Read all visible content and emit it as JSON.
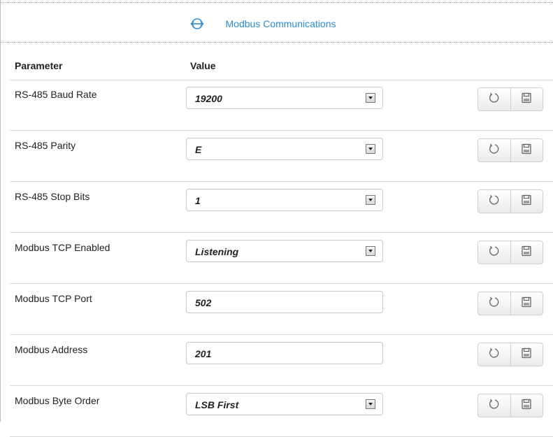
{
  "header": {
    "title": "Modbus Communications",
    "icon": "link-arrows-icon",
    "accent_color": "#2a8bd6"
  },
  "table": {
    "columns": [
      "Parameter",
      "Value"
    ],
    "rows": [
      {
        "label": "RS-485 Baud Rate",
        "value": "19200",
        "control": "select"
      },
      {
        "label": "RS-485 Parity",
        "value": "E",
        "control": "select"
      },
      {
        "label": "RS-485 Stop Bits",
        "value": "1",
        "control": "select"
      },
      {
        "label": "Modbus TCP Enabled",
        "value": "Listening",
        "control": "select"
      },
      {
        "label": "Modbus TCP Port",
        "value": "502",
        "control": "text"
      },
      {
        "label": "Modbus Address",
        "value": "201",
        "control": "text"
      },
      {
        "label": "Modbus Byte Order",
        "value": "LSB First",
        "control": "select"
      }
    ],
    "row_actions": [
      "refresh-icon",
      "save-icon"
    ]
  }
}
